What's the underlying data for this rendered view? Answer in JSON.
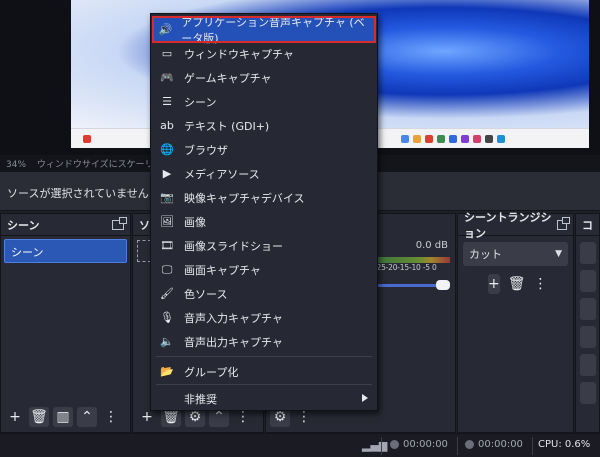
{
  "preview": {
    "zoom": "34%",
    "scaling_notice": "ウィンドウサイズにスケーリング表"
  },
  "source_bar": {
    "text": "ソースが選択されていません"
  },
  "scenes_dock": {
    "title": "シーン",
    "items": [
      "シーン"
    ]
  },
  "sources_dock": {
    "title": "ソ"
  },
  "audio": {
    "db": "0.0 dB",
    "scale": "-25-20-15-10 -5 0"
  },
  "transition_dock": {
    "title": "シーントランジション",
    "selected": "カット"
  },
  "controls_dock": {
    "title": "コ"
  },
  "statusbar": {
    "rec_time": "00:00:00",
    "stream_time": "00:00:00",
    "cpu": "CPU: 0.6%"
  },
  "menu": {
    "items": [
      {
        "label": "アプリケーション音声キャプチャ (ベータ版)",
        "icon": "audio-app-icon",
        "highlighted": true
      },
      {
        "label": "ウィンドウキャプチャ",
        "icon": "window-icon"
      },
      {
        "label": "ゲームキャプチャ",
        "icon": "gamepad-icon"
      },
      {
        "label": "シーン",
        "icon": "list-icon"
      },
      {
        "label": "テキスト (GDI+)",
        "icon": "text-icon"
      },
      {
        "label": "ブラウザ",
        "icon": "globe-icon"
      },
      {
        "label": "メディアソース",
        "icon": "play-icon"
      },
      {
        "label": "映像キャプチャデバイス",
        "icon": "camera-icon"
      },
      {
        "label": "画像",
        "icon": "image-icon"
      },
      {
        "label": "画像スライドショー",
        "icon": "slideshow-icon"
      },
      {
        "label": "画面キャプチャ",
        "icon": "monitor-icon"
      },
      {
        "label": "色ソース",
        "icon": "brush-icon"
      },
      {
        "label": "音声入力キャプチャ",
        "icon": "microphone-icon"
      },
      {
        "label": "音声出力キャプチャ",
        "icon": "speaker-icon"
      }
    ],
    "group": {
      "label": "グループ化",
      "icon": "folder-icon"
    },
    "deprecated": {
      "label": "非推奨"
    }
  },
  "colors": {
    "highlight": "#2351b8",
    "highlight_border": "#d92b2b",
    "accent": "#2b57b5"
  }
}
